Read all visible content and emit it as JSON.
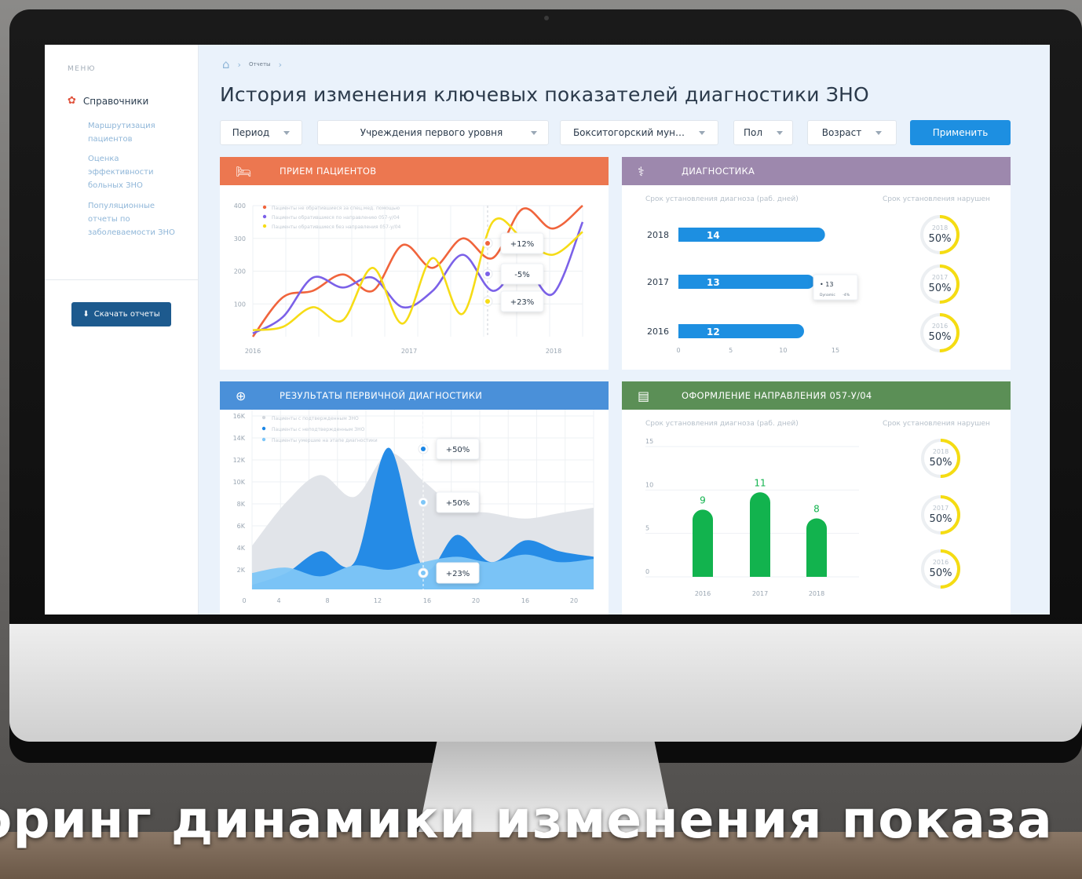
{
  "sidebar": {
    "menu_title": "МЕНЮ",
    "main_item": "Справочники",
    "sub_items": [
      "Маршрутизация пациентов",
      "Оценка эффективности больных ЗНО",
      "Популяционные отчеты по заболеваемости ЗНО"
    ],
    "download_label": "Скачать отчеты"
  },
  "breadcrumb": {
    "current": "Отчеты"
  },
  "page_title": "История изменения ключевых показателей диагностики ЗНО",
  "filters": {
    "period": "Период",
    "institutions": "Учреждения первого уровня",
    "district": "Бокситогорский мун…",
    "sex": "Пол",
    "age": "Возраст",
    "apply": "Применить"
  },
  "cards": {
    "patients": {
      "title": "ПРИЕМ ПАЦИЕНТОВ",
      "color": "#ec7750",
      "chart_data": {
        "type": "line",
        "x_labels": [
          "2016",
          "2017",
          "2018"
        ],
        "ylim": [
          0,
          400
        ],
        "y_ticks": [
          "400",
          "300",
          "200",
          "100"
        ],
        "series": [
          {
            "name": "Пациенты не обратившиеся за спец.мед. помощью",
            "color": "#f0643c",
            "values": [
              0,
              120,
              140,
              190,
              140,
              280,
              210,
              300,
              240,
              390,
              330,
              400
            ],
            "callout": "+12%"
          },
          {
            "name": "Пациенты обратившиеся по направлению 057-у/04",
            "color": "#7b61e8",
            "values": [
              10,
              60,
              180,
              150,
              180,
              90,
              140,
              250,
              140,
              220,
              130,
              350
            ],
            "callout": "-5%"
          },
          {
            "name": "Пациенты обратившиеся без направления 057-у/04",
            "color": "#f6dc16",
            "values": [
              20,
              30,
              90,
              50,
              210,
              40,
              240,
              70,
              350,
              300,
              250,
              320
            ],
            "callout": "+23%"
          }
        ]
      }
    },
    "diagnostics": {
      "title": "ДИАГНОСТИКА",
      "color": "#9d88ad",
      "left_caption": "Срок установления диагноза (раб. дней)",
      "right_caption": "Срок установления нарушен",
      "tooltip_value": "13",
      "tooltip_label": "Dynamic",
      "tooltip_change": "-4%",
      "chart_data": {
        "type": "bar",
        "orientation": "horizontal",
        "categories": [
          "2018",
          "2017",
          "2016"
        ],
        "values": [
          14,
          13,
          12
        ],
        "xlim": [
          0,
          15
        ],
        "x_ticks": [
          "0",
          "5",
          "10",
          "15"
        ]
      },
      "gauges": [
        {
          "year": "2018",
          "value": "50%",
          "fraction": 0.5
        },
        {
          "year": "2017",
          "value": "50%",
          "fraction": 0.5
        },
        {
          "year": "2016",
          "value": "50%",
          "fraction": 0.5
        }
      ]
    },
    "results": {
      "title": "РЕЗУЛЬТАТЫ ПЕРВИЧНОЙ ДИАГНОСТИКИ",
      "color": "#4a90d9",
      "chart_data": {
        "type": "area",
        "x_labels": [
          "0",
          "4",
          "8",
          "12",
          "16",
          "20",
          "16",
          "20"
        ],
        "ylim": [
          0,
          16000
        ],
        "y_ticks": [
          "16K",
          "14K",
          "12K",
          "10K",
          "8K",
          "6K",
          "4K",
          "2K"
        ],
        "series": [
          {
            "name": "Пациенты с подтвержденным ЗНО",
            "color": "#dfe3e8",
            "values": [
              4000,
              8000,
              10500,
              8500,
              12500,
              10000,
              7500,
              7000,
              6500,
              7000,
              7500
            ]
          },
          {
            "name": "Пациенты с неподтвержденным ЗНО",
            "color": "#1a86e6",
            "values": [
              400,
              1500,
              3500,
              2500,
              13000,
              2000,
              5000,
              2500,
              4500,
              3500,
              3000
            ]
          },
          {
            "name": "Пациенты умершие на этапе диагностики",
            "color": "#7ec6f7",
            "values": [
              1500,
              2000,
              1200,
              2200,
              1800,
              2500,
              3000,
              2500,
              3200,
              2500,
              2800
            ]
          }
        ],
        "callouts": [
          "+50%",
          "+50%",
          "+23%"
        ]
      }
    },
    "referral": {
      "title": "ОФОРМЛЕНИЕ НАПРАВЛЕНИЯ 057-У/04",
      "color": "#5b8f56",
      "left_caption": "Срок установления диагноза (раб. дней)",
      "right_caption": "Срок установления нарушен",
      "chart_data": {
        "type": "bar",
        "categories": [
          "2016",
          "2017",
          "2018"
        ],
        "values": [
          9,
          11,
          8
        ],
        "ylim": [
          0,
          15
        ],
        "y_ticks": [
          "15",
          "10",
          "5",
          "0"
        ]
      },
      "gauges": [
        {
          "year": "2018",
          "value": "50%",
          "fraction": 0.5
        },
        {
          "year": "2017",
          "value": "50%",
          "fraction": 0.5
        },
        {
          "year": "2016",
          "value": "50%",
          "fraction": 0.5
        }
      ]
    }
  },
  "caption": "оринг динамики изменения показа"
}
